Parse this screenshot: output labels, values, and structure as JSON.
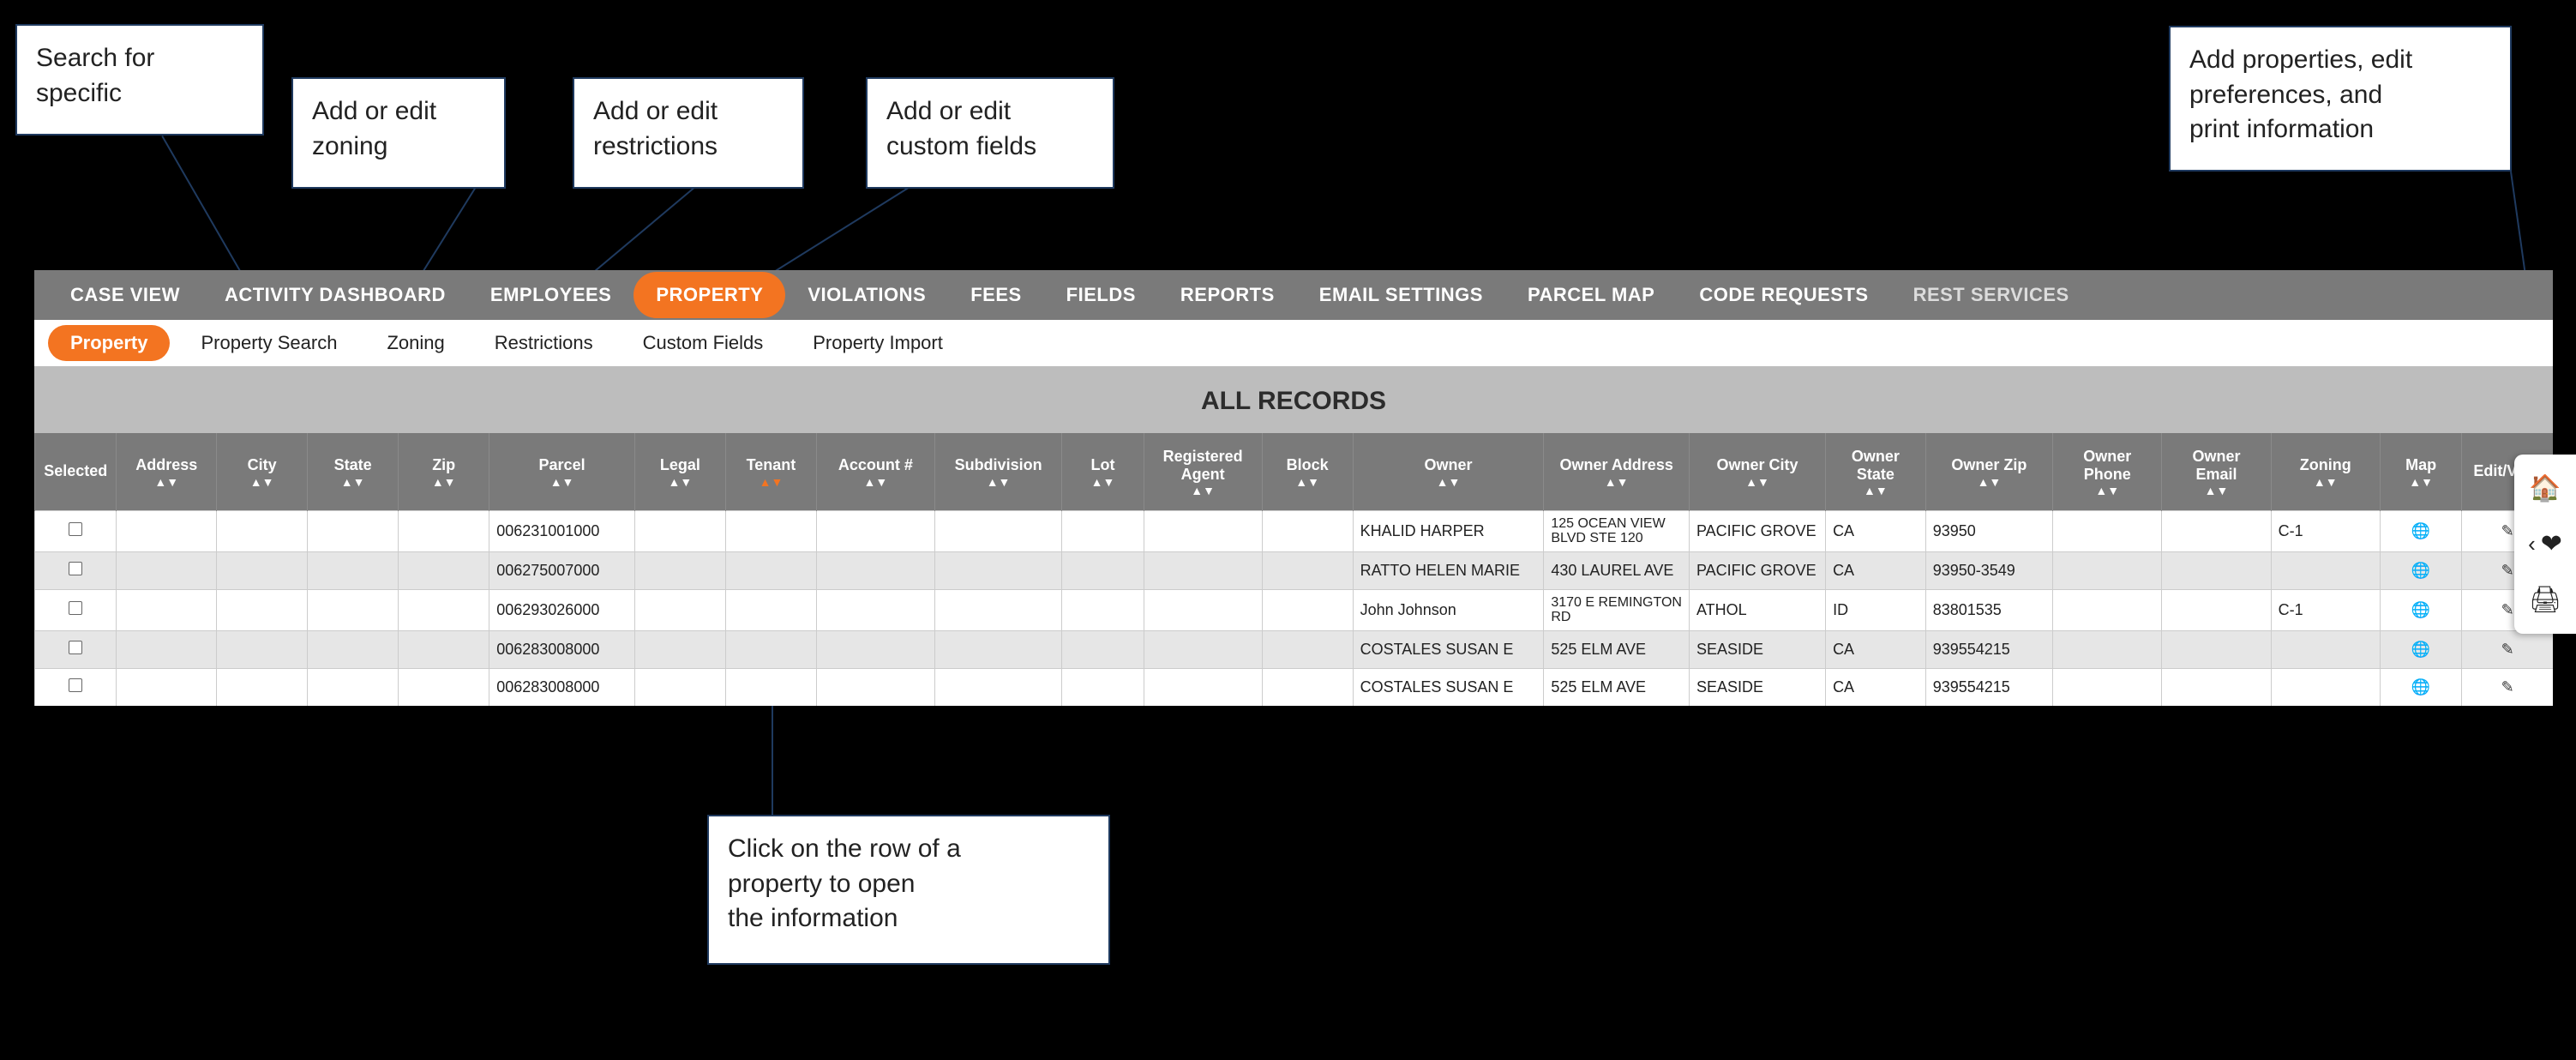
{
  "callouts": {
    "search": "Search for\nspecific",
    "zoning": "Add or edit\nzoning",
    "restrictions": "Add or edit\nrestrictions",
    "custom": "Add or edit\ncustom fields",
    "right": "Add properties, edit\npreferences, and\nprint information",
    "row": "Click on the row of a\nproperty to open\nthe information"
  },
  "mainNav": {
    "item0": "CASE VIEW",
    "item1": "ACTIVITY DASHBOARD",
    "item2": "EMPLOYEES",
    "item3": "PROPERTY",
    "item4": "VIOLATIONS",
    "item5": "FEES",
    "item6": "FIELDS",
    "item7": "REPORTS",
    "item8": "EMAIL SETTINGS",
    "item9": "PARCEL MAP",
    "item10": "CODE REQUESTS",
    "item11": "REST SERVICES"
  },
  "subNav": {
    "pill": "Property",
    "item0": "Property Search",
    "item1": "Zoning",
    "item2": "Restrictions",
    "item3": "Custom Fields",
    "item4": "Property Import"
  },
  "pageTitle": "ALL RECORDS",
  "columns": {
    "selected": "Selected",
    "address": "Address",
    "city": "City",
    "state": "State",
    "zip": "Zip",
    "parcel": "Parcel",
    "legal": "Legal",
    "tenant": "Tenant",
    "account": "Account #",
    "subdivision": "Subdivision",
    "lot": "Lot",
    "registeredAgent": "Registered\nAgent",
    "block": "Block",
    "owner": "Owner",
    "ownerAddress": "Owner Address",
    "ownerCity": "Owner City",
    "ownerState": "Owner\nState",
    "ownerZip": "Owner Zip",
    "ownerPhone": "Owner\nPhone",
    "ownerEmail": "Owner\nEmail",
    "zoning": "Zoning",
    "map": "Map",
    "editView": "Edit/View"
  },
  "rows": {
    "r0": {
      "parcel": "006231001000",
      "owner": "KHALID HARPER",
      "ownerAddress": "125 OCEAN VIEW BLVD STE 120",
      "ownerCity": "PACIFIC GROVE",
      "ownerState": "CA",
      "ownerZip": "93950",
      "zoning": "C-1"
    },
    "r1": {
      "parcel": "006275007000",
      "owner": "RATTO HELEN MARIE",
      "ownerAddress": "430 LAUREL AVE",
      "ownerCity": "PACIFIC GROVE",
      "ownerState": "CA",
      "ownerZip": "93950-3549",
      "zoning": ""
    },
    "r2": {
      "parcel": "006293026000",
      "owner": "John Johnson",
      "ownerAddress": "3170 E REMINGTON RD",
      "ownerCity": "ATHOL",
      "ownerState": "ID",
      "ownerZip": "83801535",
      "zoning": "C-1"
    },
    "r3": {
      "parcel": "006283008000",
      "owner": "COSTALES SUSAN E",
      "ownerAddress": "525 ELM AVE",
      "ownerCity": "SEASIDE",
      "ownerState": "CA",
      "ownerZip": "939554215",
      "zoning": ""
    },
    "r4": {
      "parcel": "006283008000",
      "owner": "COSTALES SUSAN E",
      "ownerAddress": "525 ELM AVE",
      "ownerCity": "SEASIDE",
      "ownerState": "CA",
      "ownerZip": "939554215",
      "zoning": ""
    }
  }
}
